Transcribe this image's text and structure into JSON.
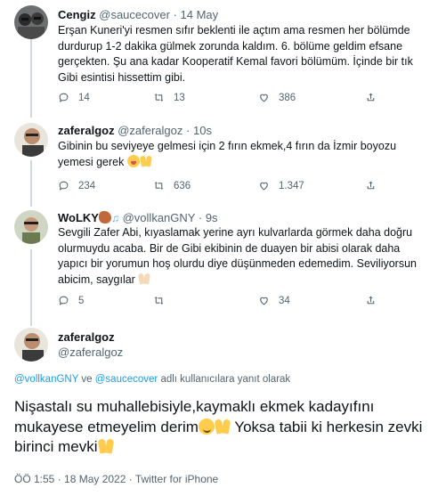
{
  "thread": [
    {
      "name": "Cengiz",
      "handle": "@saucecover",
      "separator": "·",
      "time": "14 May",
      "text": "Erşan Kuneri'yi resmen sıfır beklenti ile açtım ama resmen her bölümde durdurup 1-2 dakika gülmek zorunda kaldım. 6. bölüme geldim efsane gerçekten. Şu ana kadar Kooperatif Kemal favori bölümüm. İçinde bir tık Gibi esintisi hissettim gibi.",
      "replies": "14",
      "retweets": "13",
      "likes": "386"
    },
    {
      "name": "zaferalgoz",
      "handle": "@zaferalgoz",
      "separator": "·",
      "time": "10s",
      "text": "Gibinin bu seviyeye gelmesi için 2 fırın ekmek,4 fırın da İzmir boyozu yemesi gerek",
      "replies": "234",
      "retweets": "636",
      "likes": "1.347"
    },
    {
      "name": "WoLKY",
      "handle": "@vollkanGNY",
      "separator": "·",
      "time": "9s",
      "text": "Sevgili Zafer Abi, kıyaslamak yerine ayrı kulvarlarda görmek daha doğru olurmuydu acaba. Bir de Gibi ekibinin de duayen bir abisi olarak daha yapıcı bir yorumun hoş olurdu diye düşünmeden edemedim. Seviliyorsun abicim, saygılar",
      "replies": "5",
      "retweets": "",
      "likes": "34"
    }
  ],
  "main_tweet": {
    "name": "zaferalgoz",
    "handle": "@zaferalgoz",
    "replying_to_user1": "@vollkanGNY",
    "replying_joiner": "ve",
    "replying_to_user2": "@saucecover",
    "replying_suffix": "adlı kullanıcılara yanıt olarak",
    "text_part1": "Nişastalı su muhallebisiyle,kaymaklı ekmek kadayıfını mukayese etmeyelim derim",
    "text_part2": "Yoksa tabii ki herkesin zevki birinci mevki",
    "timestamp": "ÖÖ 1:55 · 18 May 2022 · Twitter for iPhone"
  },
  "colors": {
    "link": "#1d9bf0",
    "secondary_text": "#536471",
    "thread_line": "#cfd9de"
  },
  "icons": [
    "reply-icon",
    "retweet-icon",
    "like-icon",
    "share-icon"
  ]
}
